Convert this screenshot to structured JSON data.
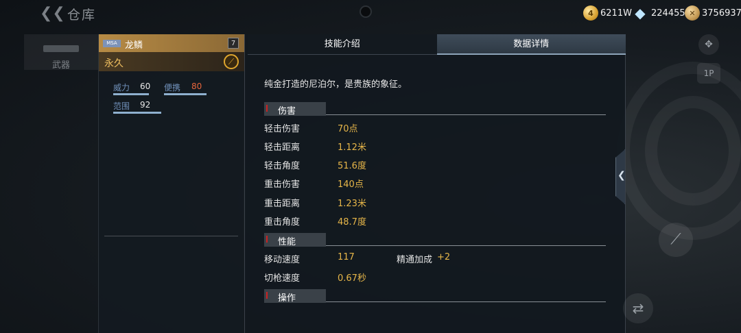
{
  "header": {
    "title": "仓库",
    "currencies": [
      {
        "icon": "gold-coin-icon",
        "glyph": "4",
        "value": "6211W"
      },
      {
        "icon": "diamond-icon",
        "glyph": "◆",
        "value": "224455"
      },
      {
        "icon": "honor-coin-icon",
        "glyph": "✕",
        "value": "3756937"
      }
    ]
  },
  "sidebar": {
    "tab_label": "武器"
  },
  "weapon": {
    "tag": "MSA",
    "name": "龙鳞",
    "level": "7",
    "durability": "永久",
    "stats": [
      {
        "label": "威力",
        "value": "60"
      },
      {
        "label": "便携",
        "value": "80"
      },
      {
        "label": "范围",
        "value": "92"
      }
    ]
  },
  "tabs": [
    {
      "label": "技能介绍",
      "active": false
    },
    {
      "label": "数据详情",
      "active": true
    }
  ],
  "detail": {
    "description": "纯金打造的尼泊尔，是贵族的象征。",
    "sections": [
      {
        "title": "伤害",
        "rows": [
          {
            "label": "轻击伤害",
            "value": "70点"
          },
          {
            "label": "轻击距离",
            "value": "1.12米"
          },
          {
            "label": "轻击角度",
            "value": "51.6度"
          },
          {
            "label": "重击伤害",
            "value": "140点"
          },
          {
            "label": "重击距离",
            "value": "1.23米"
          },
          {
            "label": "重击角度",
            "value": "48.7度"
          }
        ]
      },
      {
        "title": "性能",
        "rows": [
          {
            "label": "移动速度",
            "value": "117",
            "extra_label": "精通加成",
            "extra_value": "+2"
          },
          {
            "label": "切枪速度",
            "value": "0.67秒"
          }
        ]
      },
      {
        "title": "操作",
        "rows": []
      }
    ]
  },
  "controls": {
    "view_button": "1P"
  },
  "colors": {
    "accent_gold": "#e7b649",
    "name_bar": "#b78b45",
    "stat_label": "#6f8fb8",
    "stat_bar": "#8fb0cf",
    "section_mark": "#cc2222"
  }
}
